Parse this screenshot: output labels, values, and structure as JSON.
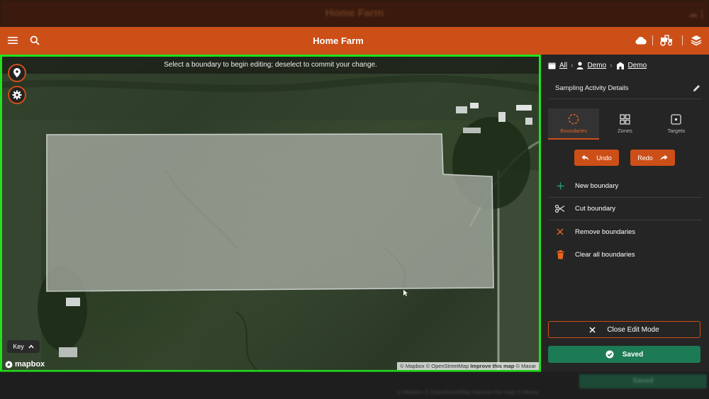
{
  "ghost_header": {
    "title": "Home Farm"
  },
  "header": {
    "title": "Home Farm",
    "icons": [
      "menu-icon",
      "search-icon",
      "cloud-icon",
      "tractor-icon",
      "layers-icon"
    ]
  },
  "map": {
    "banner": "Select a boundary to begin editing; deselect to commit your change.",
    "key_label": "Key",
    "logo_text": "mapbox",
    "attribution": {
      "mapbox": "© Mapbox",
      "osm": "© OpenStreetMap",
      "improve": "Improve this map",
      "maxar": "© Maxar"
    },
    "border_color": "#22e01e"
  },
  "panel": {
    "breadcrumb": {
      "all": "All",
      "client": "Demo",
      "farm": "Demo"
    },
    "activity_title": "Sampling Activity Details",
    "tabs": [
      {
        "label": "Boundaries",
        "icon": "dashed-circle-icon",
        "active": true
      },
      {
        "label": "Zones",
        "icon": "grid-icon",
        "active": false
      },
      {
        "label": "Targets",
        "icon": "target-icon",
        "active": false
      }
    ],
    "undo_label": "Undo",
    "redo_label": "Redo",
    "actions": [
      {
        "label": "New boundary",
        "icon": "plus-icon"
      },
      {
        "label": "Cut boundary",
        "icon": "scissors-icon"
      },
      {
        "label": "Remove boundaries",
        "icon": "x-icon"
      },
      {
        "label": "Clear all boundaries",
        "icon": "trash-icon"
      }
    ],
    "close_edit_label": "Close Edit Mode",
    "saved_label": "Saved"
  },
  "colors": {
    "accent": "#cc4f18",
    "success": "#1c7a55",
    "panel_bg": "#252525"
  },
  "ghost_footer": {
    "saved_label": "Saved",
    "attribution": "© Mapbox © OpenStreetMap Improve this map © Maxar"
  }
}
